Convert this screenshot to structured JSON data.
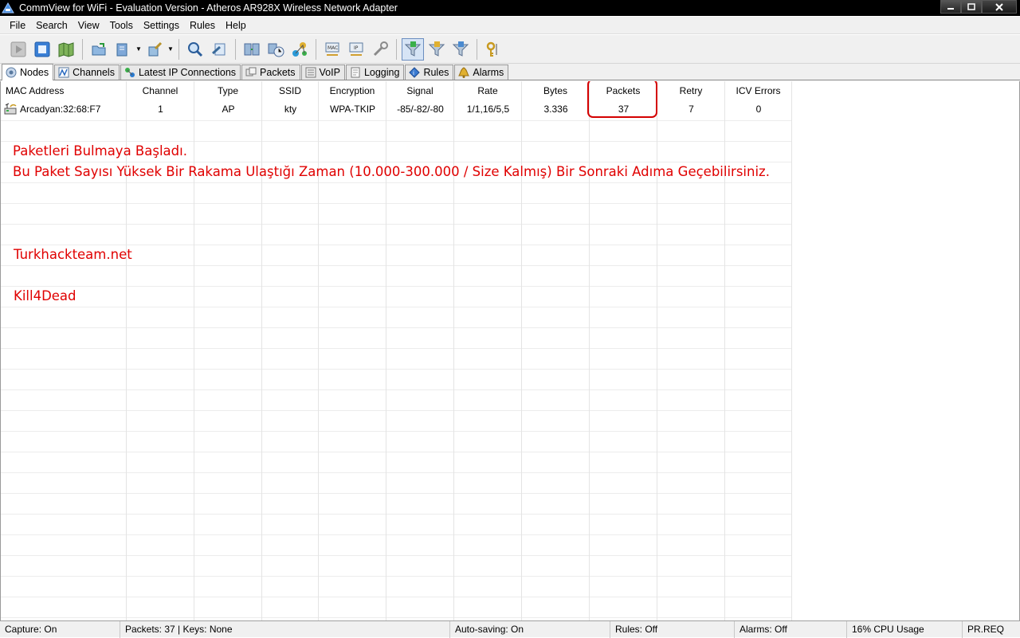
{
  "window": {
    "title": "CommView for WiFi - Evaluation Version - Atheros AR928X Wireless Network Adapter",
    "buttons": [
      "minimize",
      "maximize",
      "close"
    ]
  },
  "menu": [
    "File",
    "Search",
    "View",
    "Tools",
    "Settings",
    "Rules",
    "Help"
  ],
  "toolbar": {
    "icons": [
      "start-capture-icon",
      "stop-capture-icon",
      "map-icon",
      "open-icon",
      "save-icon",
      "brush-icon",
      "search-icon",
      "logging-icon",
      "nodes-icon",
      "reconstruct-icon",
      "statistics-icon",
      "mac-alias-icon",
      "ip-alias-icon",
      "tools-icon",
      "data-filter-icon",
      "mgmt-filter-icon",
      "control-filter-icon",
      "wep-keys-icon"
    ]
  },
  "tabs": [
    {
      "label": "Nodes",
      "icon": "nodes-tab-icon",
      "active": true
    },
    {
      "label": "Channels",
      "icon": "channels-tab-icon"
    },
    {
      "label": "Latest IP Connections",
      "icon": "ip-connections-tab-icon"
    },
    {
      "label": "Packets",
      "icon": "packets-tab-icon"
    },
    {
      "label": "VoIP",
      "icon": "voip-tab-icon"
    },
    {
      "label": "Logging",
      "icon": "logging-tab-icon"
    },
    {
      "label": "Rules",
      "icon": "rules-tab-icon"
    },
    {
      "label": "Alarms",
      "icon": "alarms-tab-icon"
    }
  ],
  "table": {
    "columns": [
      "MAC Address",
      "Channel",
      "Type",
      "SSID",
      "Encryption",
      "Signal",
      "Rate",
      "Bytes",
      "Packets",
      "Retry",
      "ICV Errors"
    ],
    "rows": [
      [
        "Arcadyan:32:68:F7",
        "1",
        "AP",
        "kty",
        "WPA-TKIP",
        "-85/-82/-80",
        "1/1,16/5,5",
        "3.336",
        "37",
        "7",
        "0"
      ]
    ]
  },
  "annotations": {
    "line1": "Paketleri Bulmaya Başladı.",
    "line2": "Bu Paket Sayısı Yüksek Bir Rakama Ulaştığı Zaman (10.000-300.000 / Size Kalmış) Bir Sonraki Adıma Geçebilirsiniz.",
    "site": "Turkhackteam.net",
    "author": "Kill4Dead",
    "color": "#e00000"
  },
  "status": {
    "capture": "Capture: On",
    "packets_keys": "Packets: 37 | Keys: None",
    "autosave": "Auto-saving: On",
    "rules": "Rules: Off",
    "alarms": "Alarms: Off",
    "cpu": "16% CPU Usage",
    "extra": "PR.REQ"
  }
}
